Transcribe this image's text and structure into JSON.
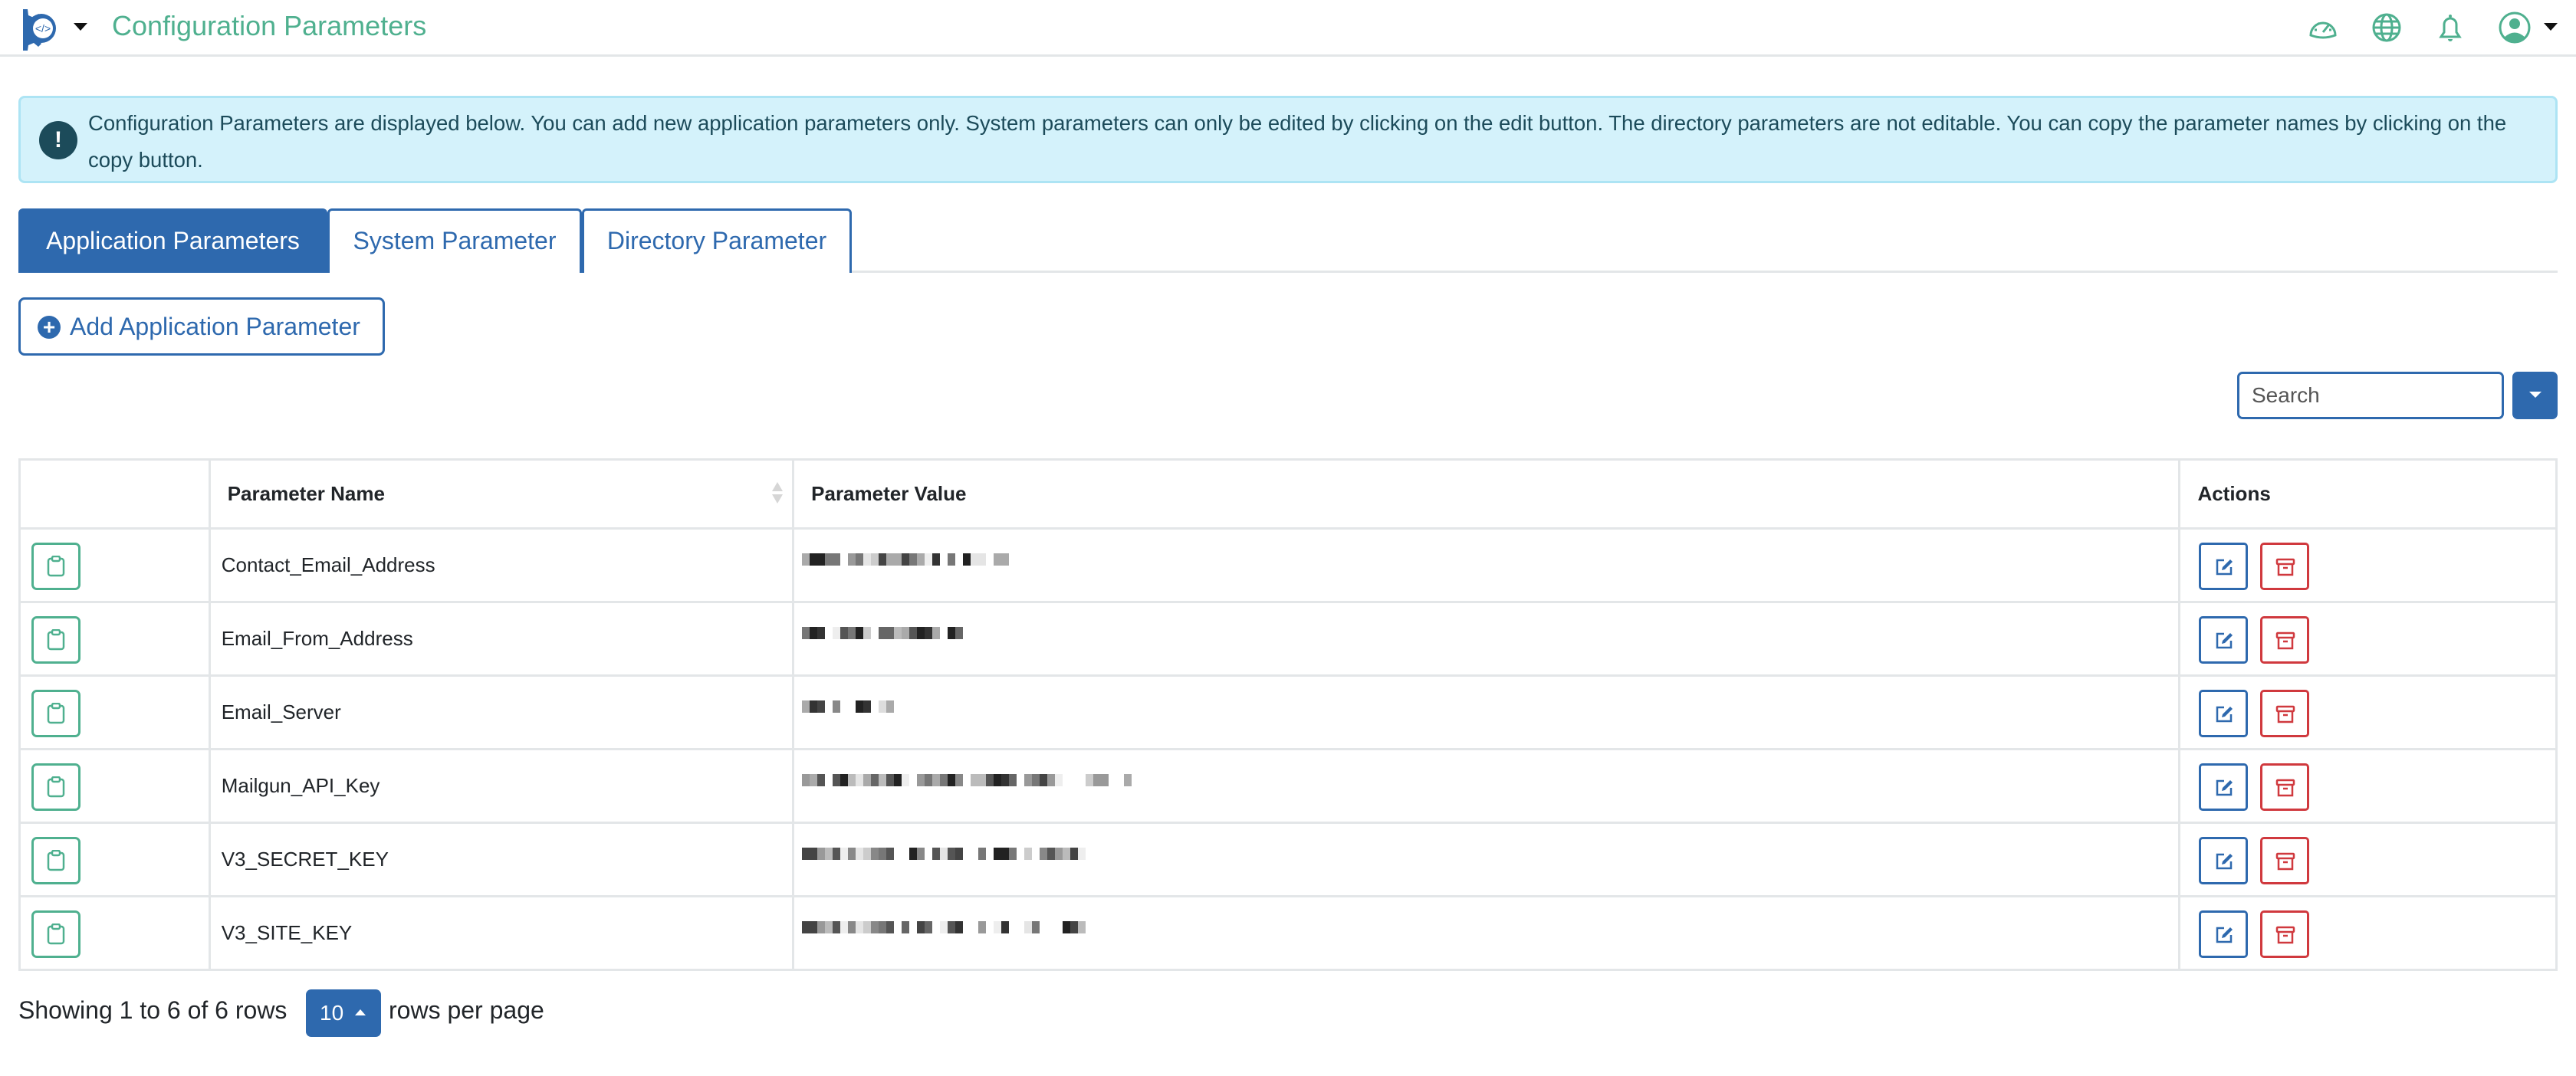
{
  "header": {
    "title": "Configuration Parameters",
    "icons": [
      "dashboard-gauge-icon",
      "globe-icon",
      "bell-icon",
      "user-avatar-icon"
    ],
    "accent_color": "#4fb08f"
  },
  "alert": {
    "icon": "exclamation-icon",
    "icon_glyph": "!",
    "text": "Configuration Parameters are displayed below. You can add new application parameters only. System parameters can only be edited by clicking on the edit button. The directory parameters are not editable. You can copy the parameter names by clicking on the copy button."
  },
  "tabs": [
    {
      "label": "Application Parameters",
      "active": true
    },
    {
      "label": "System Parameter",
      "active": false
    },
    {
      "label": "Directory Parameter",
      "active": false
    }
  ],
  "toolbar": {
    "add_label": "Add Application Parameter",
    "search_placeholder": "Search",
    "search_value": ""
  },
  "table": {
    "columns": [
      "",
      "Parameter Name",
      "Parameter Value",
      "Actions"
    ],
    "rows": [
      {
        "name": "Contact_Email_Address",
        "value": "[redacted]",
        "mask": [
          "#aaa",
          "#222",
          "#222",
          "#777",
          "#777",
          "",
          "#999",
          "#777",
          "#e5e5e5",
          "#ccc",
          "#444",
          "#aaa",
          "#aaa",
          "#444",
          "#777",
          "#aaa",
          "#eee",
          "#333",
          "",
          "#777",
          "",
          "#222",
          "#e5e5e5",
          "#e5e5e5",
          "",
          "#aaa",
          "#aaa"
        ]
      },
      {
        "name": "Email_From_Address",
        "value": "[redacted]",
        "mask": [
          "#777",
          "#222",
          "#333",
          "",
          "#eee",
          "#555",
          "#777",
          "#222",
          "#ccc",
          "",
          "#666",
          "#666",
          "#bbb",
          "#aaa",
          "#555",
          "#222",
          "#333",
          "#aaa",
          "",
          "#222",
          "#666"
        ]
      },
      {
        "name": "Email_Server",
        "value": "[redacted]",
        "mask": [
          "#aaa",
          "#333",
          "#444",
          "",
          "#888",
          "",
          "",
          "#222",
          "#333",
          "",
          "#ddd",
          "#aaa"
        ]
      },
      {
        "name": "Mailgun_API_Key",
        "value": "[redacted]",
        "mask": [
          "#999",
          "#aaa",
          "#555",
          "",
          "#555",
          "#222",
          "#bbb",
          "#e5e5e5",
          "#aaa",
          "#666",
          "#bbb",
          "#555",
          "#222",
          "#eee",
          "",
          "#999",
          "#777",
          "#aaa",
          "#777",
          "#222",
          "#888",
          "",
          "#bbb",
          "#bbb",
          "#555",
          "#222",
          "#333",
          "#666",
          "",
          "#999",
          "#777",
          "#444",
          "#999",
          "#eee",
          "",
          "",
          "",
          "#ccc",
          "#999",
          "#999",
          "",
          "",
          "#aaa"
        ]
      },
      {
        "name": "V3_SECRET_KEY",
        "value": "[redacted]",
        "mask": [
          "#444",
          "#444",
          "#999",
          "#bbb",
          "#555",
          "#eee",
          "#888",
          "#e5e5e5",
          "#ccc",
          "#888",
          "#777",
          "#555",
          "",
          "",
          "#222",
          "#888",
          "",
          "#555",
          "#e5e5e5",
          "#555",
          "#444",
          "",
          "",
          "#777",
          "",
          "#222",
          "#222",
          "#777",
          "",
          "#ccc",
          "",
          "#888",
          "#555",
          "#999",
          "#bbb",
          "#444",
          "#eee"
        ]
      },
      {
        "name": "V3_SITE_KEY",
        "value": "[redacted]",
        "mask": [
          "#444",
          "#444",
          "#999",
          "#bbb",
          "#555",
          "#eee",
          "#888",
          "#e5e5e5",
          "#ccc",
          "#888",
          "#777",
          "#555",
          "",
          "#666",
          "",
          "#444",
          "#666",
          "",
          "#eee",
          "#555",
          "#333",
          "",
          "",
          "#999",
          "",
          "#eee",
          "#333",
          "",
          "",
          "#e5e5e5",
          "#777",
          "",
          "",
          "",
          "#222",
          "#444",
          "#bbb"
        ]
      }
    ],
    "row_actions": {
      "copy": "clipboard-icon",
      "edit": "edit-icon",
      "delete": "archive-icon"
    }
  },
  "pagination": {
    "showing_text": "Showing 1 to 6 of 6 rows",
    "page_size": "10",
    "suffix_text": "rows per page"
  }
}
